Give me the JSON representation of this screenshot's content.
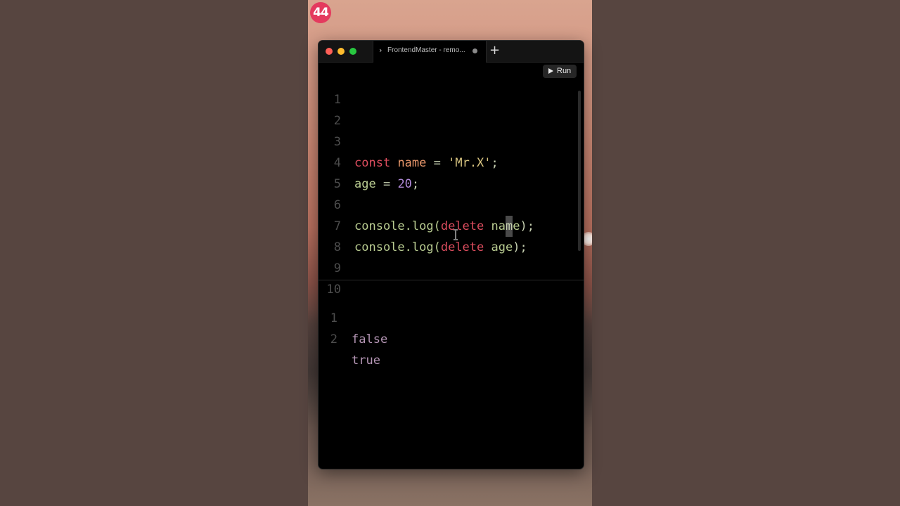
{
  "badge": {
    "text": "44"
  },
  "window": {
    "tab": {
      "chevron": "›",
      "title": "FrontendMaster - remo...",
      "add": "+"
    },
    "run_button": {
      "label": "Run"
    }
  },
  "editor": {
    "line_numbers": [
      "1",
      "2",
      "3",
      "4",
      "5",
      "6",
      "7",
      "8",
      "9",
      "10"
    ],
    "lines": {
      "l3": {
        "kw": "const",
        "sp1": " ",
        "var": "name",
        "op": " = ",
        "str": "'Mr.X'",
        "end": ";"
      },
      "l4": {
        "var": "age",
        "op": " = ",
        "num": "20",
        "end": ";"
      },
      "l6": {
        "fn": "console.log(",
        "kw": "delete",
        "sp": " ",
        "arg_a": "na",
        "arg_cursor": "m",
        "arg_b": "e",
        "end": ");"
      },
      "l7": {
        "fn": "console.log(",
        "kw": "delete",
        "sp": " ",
        "arg": "age",
        "end": ");"
      }
    }
  },
  "output": {
    "lines": [
      {
        "num": "1",
        "value": "false"
      },
      {
        "num": "2",
        "value": "true"
      }
    ]
  },
  "colors": {
    "keyword": "#dc4d5e",
    "variable": "#e7966a",
    "string": "#d8c480",
    "number": "#b08ad8",
    "function": "#b9cc91",
    "output": "#b596b5",
    "badge": "#e43a5e"
  }
}
